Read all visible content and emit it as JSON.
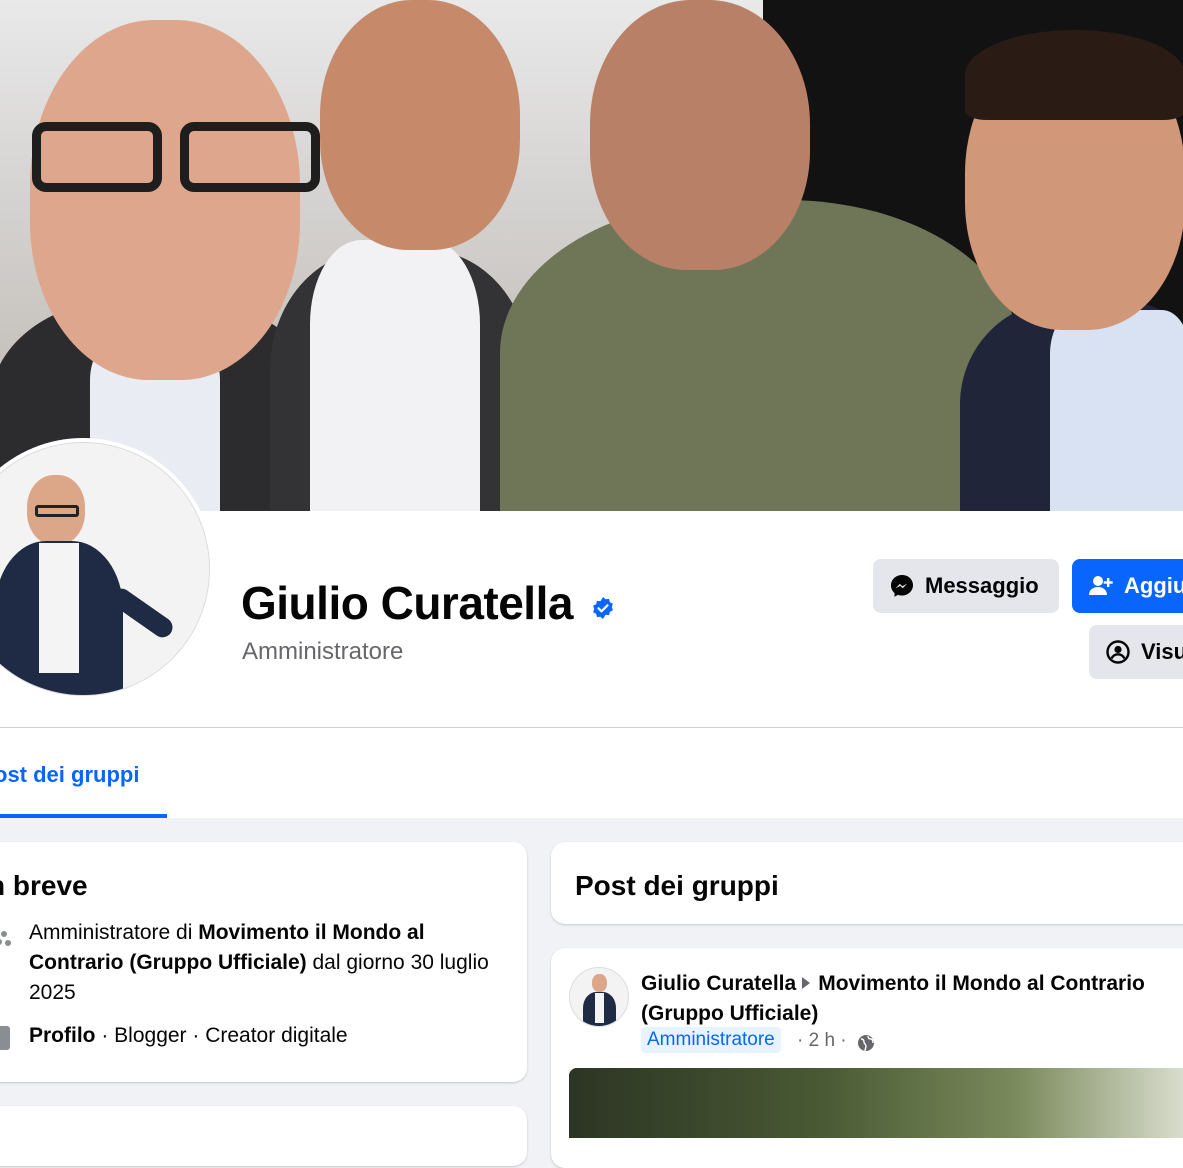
{
  "profile": {
    "name": "Giulio Curatella",
    "role": "Amministratore",
    "verified": true
  },
  "actions": {
    "message_label": "Messaggio",
    "add_label": "Aggiu",
    "view_label": "Visu"
  },
  "tabs": {
    "active_label": "ost dei gruppi"
  },
  "intro": {
    "title": "n breve",
    "admin_prefix": "Amministratore di ",
    "group_name": "Movimento il Mondo al Contrario (Gruppo Ufficiale)",
    "admin_suffix": " dal giorno 30 luglio 2025",
    "profile_label": "Profilo",
    "profile_rest": " · Blogger · Creator digitale"
  },
  "posts": {
    "title": "Post dei gruppi",
    "item": {
      "author": "Giulio Curatella",
      "group": "Movimento il Mondo al Contrario (Gruppo Ufficiale)",
      "badge": "Amministratore",
      "time": "· 2 h ·"
    }
  },
  "colors": {
    "accent": "#0866ff",
    "background": "#f0f2f5",
    "secondary_text": "#65676b"
  },
  "icons": [
    "messenger-icon",
    "add-friend-icon",
    "view-profile-icon",
    "verified-badge-icon",
    "groups-icon",
    "category-icon",
    "globe-icon"
  ]
}
